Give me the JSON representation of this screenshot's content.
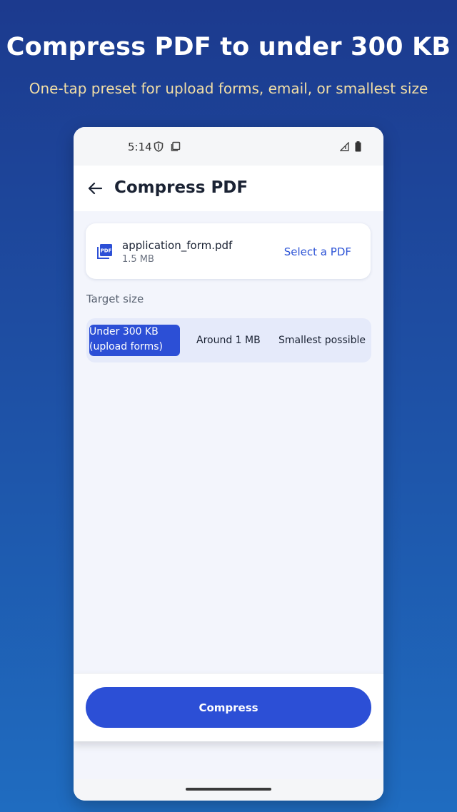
{
  "promo": {
    "headline": "Compress PDF to under 300 KB",
    "subline": "One-tap preset for upload forms, email, or smallest size"
  },
  "status_bar": {
    "time": "5:14",
    "icons": [
      "shield-icon",
      "clipboard-icon",
      "signal-icon",
      "battery-icon"
    ]
  },
  "app_bar": {
    "title": "Compress PDF",
    "back_icon": "arrow-left-icon"
  },
  "file": {
    "name": "application_form.pdf",
    "size": "1.5 MB",
    "icon": "pdf-icon",
    "select_label": "Select a PDF"
  },
  "target": {
    "label": "Target size",
    "options": [
      {
        "line1": "Under 300 KB",
        "line2": "(upload forms)",
        "selected": true
      },
      {
        "label": "Around 1 MB",
        "selected": false
      },
      {
        "label": "Smallest possible",
        "selected": false
      }
    ]
  },
  "action": {
    "compress_label": "Compress"
  },
  "colors": {
    "accent": "#2c4fd6",
    "link": "#2c53d6",
    "subline": "#f2dfa6",
    "background_top": "#1c3a8e",
    "background_bottom": "#1f6cc0"
  }
}
